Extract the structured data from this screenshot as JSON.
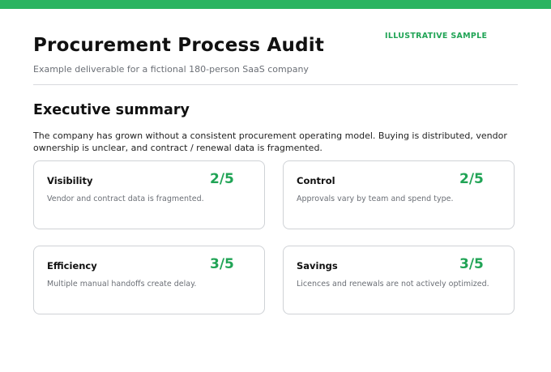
{
  "header": {
    "title": "Procurement Process Audit",
    "tag": "ILLUSTRATIVE SAMPLE",
    "subtitle": "Example deliverable for a fictional 180-person SaaS company",
    "accent_color": "#2bb461"
  },
  "executive_summary": {
    "heading": "Executive summary",
    "text": "The company has grown without a consistent procurement operating model. Buying is distributed, vendor ownership is unclear, and contract / renewal data is fragmented."
  },
  "scorecards": [
    {
      "title": "Visibility",
      "score": "2/5",
      "description": "Vendor and contract data is fragmented."
    },
    {
      "title": "Control",
      "score": "2/5",
      "description": "Approvals vary by team and spend type."
    },
    {
      "title": "Efficiency",
      "score": "3/5",
      "description": "Multiple manual handoffs create delay."
    },
    {
      "title": "Savings",
      "score": "3/5",
      "description": "Licences and renewals are not actively optimized."
    }
  ]
}
